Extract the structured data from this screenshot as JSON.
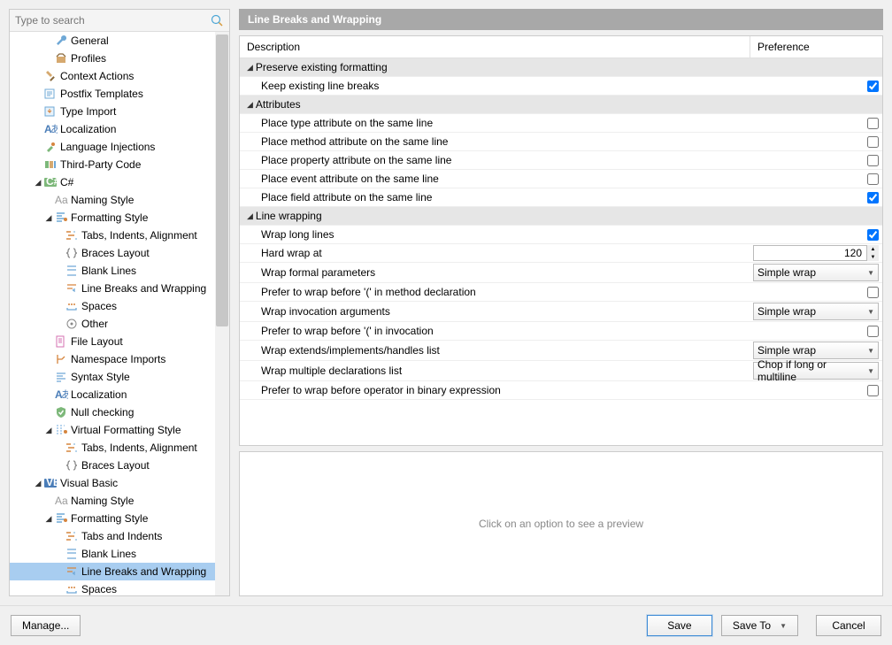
{
  "search": {
    "placeholder": "Type to search"
  },
  "sidebar": {
    "items": [
      {
        "label": "General",
        "indent": 4,
        "icon": "wrench"
      },
      {
        "label": "Profiles",
        "indent": 4,
        "icon": "profiles"
      },
      {
        "label": "Context Actions",
        "indent": 3,
        "icon": "hammer"
      },
      {
        "label": "Postfix Templates",
        "indent": 3,
        "icon": "postfix"
      },
      {
        "label": "Type Import",
        "indent": 3,
        "icon": "type-import"
      },
      {
        "label": "Localization",
        "indent": 3,
        "icon": "localization"
      },
      {
        "label": "Language Injections",
        "indent": 3,
        "icon": "injection"
      },
      {
        "label": "Third-Party Code",
        "indent": 3,
        "icon": "third-party"
      },
      {
        "label": "C#",
        "indent": 2,
        "expandable": true,
        "expanded": true,
        "icon": "cs"
      },
      {
        "label": "Naming Style",
        "indent": 4,
        "icon": "naming"
      },
      {
        "label": "Formatting Style",
        "indent": 3,
        "expandable": true,
        "expanded": true,
        "icon": "formatting"
      },
      {
        "label": "Tabs, Indents, Alignment",
        "indent": 5,
        "icon": "tabs"
      },
      {
        "label": "Braces Layout",
        "indent": 5,
        "icon": "braces"
      },
      {
        "label": "Blank Lines",
        "indent": 5,
        "icon": "blank-lines"
      },
      {
        "label": "Line Breaks and Wrapping",
        "indent": 5,
        "icon": "line-breaks"
      },
      {
        "label": "Spaces",
        "indent": 5,
        "icon": "spaces"
      },
      {
        "label": "Other",
        "indent": 5,
        "icon": "other"
      },
      {
        "label": "File Layout",
        "indent": 4,
        "icon": "file-layout"
      },
      {
        "label": "Namespace Imports",
        "indent": 4,
        "icon": "namespace"
      },
      {
        "label": "Syntax Style",
        "indent": 4,
        "icon": "syntax"
      },
      {
        "label": "Localization",
        "indent": 4,
        "icon": "localization"
      },
      {
        "label": "Null checking",
        "indent": 4,
        "icon": "null-check"
      },
      {
        "label": "Virtual Formatting Style",
        "indent": 3,
        "expandable": true,
        "expanded": true,
        "icon": "virtual-formatting"
      },
      {
        "label": "Tabs, Indents, Alignment",
        "indent": 5,
        "icon": "tabs"
      },
      {
        "label": "Braces Layout",
        "indent": 5,
        "icon": "braces"
      },
      {
        "label": "Visual Basic",
        "indent": 2,
        "expandable": true,
        "expanded": true,
        "icon": "vb"
      },
      {
        "label": "Naming Style",
        "indent": 4,
        "icon": "naming"
      },
      {
        "label": "Formatting Style",
        "indent": 3,
        "expandable": true,
        "expanded": true,
        "icon": "formatting"
      },
      {
        "label": "Tabs and Indents",
        "indent": 5,
        "icon": "tabs"
      },
      {
        "label": "Blank Lines",
        "indent": 5,
        "icon": "blank-lines"
      },
      {
        "label": "Line Breaks and Wrapping",
        "indent": 5,
        "icon": "line-breaks",
        "selected": true
      },
      {
        "label": "Spaces",
        "indent": 5,
        "icon": "spaces"
      }
    ]
  },
  "panel": {
    "title": "Line Breaks and Wrapping",
    "columns": {
      "desc": "Description",
      "pref": "Preference"
    },
    "groups": [
      {
        "name": "Preserve existing formatting",
        "rows": [
          {
            "desc": "Keep existing line breaks",
            "type": "check",
            "value": true
          }
        ]
      },
      {
        "name": "Attributes",
        "rows": [
          {
            "desc": "Place type attribute on the same line",
            "type": "check",
            "value": false
          },
          {
            "desc": "Place method attribute on the same line",
            "type": "check",
            "value": false
          },
          {
            "desc": "Place property attribute on the same line",
            "type": "check",
            "value": false
          },
          {
            "desc": "Place event attribute on the same line",
            "type": "check",
            "value": false
          },
          {
            "desc": "Place field attribute on the same line",
            "type": "check",
            "value": true
          }
        ]
      },
      {
        "name": "Line wrapping",
        "rows": [
          {
            "desc": "Wrap long lines",
            "type": "check",
            "value": true
          },
          {
            "desc": "Hard wrap at",
            "type": "number",
            "value": "120"
          },
          {
            "desc": "Wrap formal parameters",
            "type": "select",
            "value": "Simple wrap"
          },
          {
            "desc": "Prefer to wrap before '(' in method declaration",
            "type": "check",
            "value": false
          },
          {
            "desc": "Wrap invocation arguments",
            "type": "select",
            "value": "Simple wrap"
          },
          {
            "desc": "Prefer to wrap before '(' in invocation",
            "type": "check",
            "value": false
          },
          {
            "desc": "Wrap extends/implements/handles list",
            "type": "select",
            "value": "Simple wrap"
          },
          {
            "desc": "Wrap multiple declarations list",
            "type": "select",
            "value": "Chop if long or multiline"
          },
          {
            "desc": "Prefer to wrap before operator in binary expression",
            "type": "check",
            "value": false
          }
        ]
      }
    ]
  },
  "preview": {
    "placeholder": "Click on an option to see a preview"
  },
  "buttons": {
    "manage": "Manage...",
    "save": "Save",
    "saveTo": "Save To",
    "cancel": "Cancel"
  }
}
